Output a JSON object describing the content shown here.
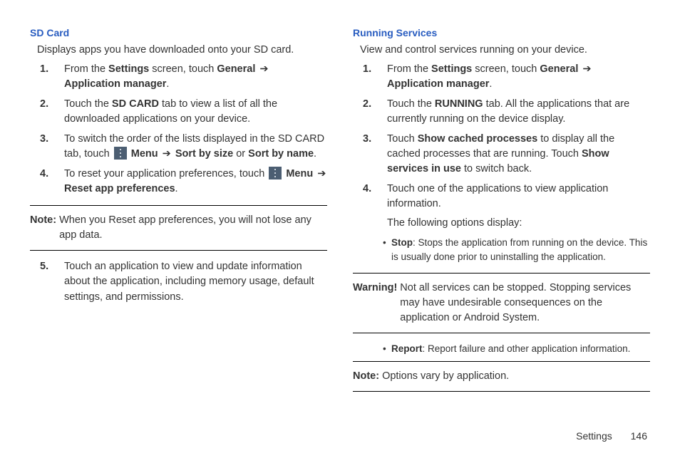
{
  "left": {
    "heading": "SD Card",
    "intro": "Displays apps you have downloaded onto your SD card.",
    "s1_a": "From the ",
    "s1_b": "Settings",
    "s1_c": " screen, touch ",
    "s1_d": "General",
    "s1_e": " ➔ ",
    "s1_f": "Application manager",
    "s1_g": ".",
    "s2_a": "Touch the ",
    "s2_b": "SD CARD",
    "s2_c": " tab to view a list of all the downloaded applications on your device.",
    "s3_a": "To switch the order of the lists displayed in the SD CARD tab, touch ",
    "s3_menu": " Menu",
    "s3_b": " ➔ ",
    "s3_c": "Sort by size",
    "s3_d": " or ",
    "s3_e": "Sort by name",
    "s3_f": ".",
    "s4_a": "To reset your application preferences, touch ",
    "s4_menu": " Menu",
    "s4_b": " ➔ ",
    "s4_c": "Reset app preferences",
    "s4_d": ".",
    "note_label": "Note:",
    "note_text": " When you Reset app preferences, you will not lose any app data.",
    "s5": "Touch an application to view and update information about the application, including memory usage, default settings, and permissions."
  },
  "right": {
    "heading": "Running Services",
    "intro": "View and control services running on your device.",
    "s1_a": "From the ",
    "s1_b": "Settings",
    "s1_c": " screen, touch ",
    "s1_d": "General",
    "s1_e": " ➔ ",
    "s1_f": "Application manager",
    "s1_g": ".",
    "s2_a": "Touch the ",
    "s2_b": "RUNNING",
    "s2_c": " tab. All the applications that are currently running on the device display.",
    "s3_a": "Touch ",
    "s3_b": "Show cached processes",
    "s3_c": " to display all the cached processes that are running. Touch ",
    "s3_d": "Show services in use",
    "s3_e": " to switch back.",
    "s4_a": "Touch one of the applications to view application information.",
    "s4_b": "The following options display:",
    "bul1_a": "Stop",
    "bul1_b": ": Stops the application from running on the device. This is usually done prior to uninstalling the application.",
    "warn_label": "Warning!",
    "warn_text": " Not all services can be stopped. Stopping services may have undesirable consequences on the application or Android System.",
    "bul2_a": "Report",
    "bul2_b": ": Report failure and other application information.",
    "note2_label": "Note:",
    "note2_text": " Options vary by application."
  },
  "footer": {
    "section": "Settings",
    "page": "146"
  }
}
